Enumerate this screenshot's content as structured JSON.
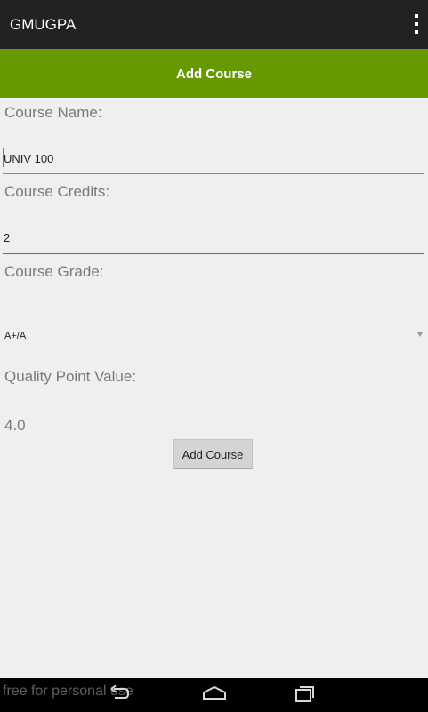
{
  "app": {
    "title": "GMUGPA"
  },
  "header": {
    "title": "Add Course"
  },
  "form": {
    "course_name": {
      "label": "Course Name:",
      "value": "UNIV 100",
      "value_part1": "UNIV",
      "value_part2": " 100"
    },
    "course_credits": {
      "label": "Course Credits:",
      "value": "2"
    },
    "course_grade": {
      "label": "Course Grade:",
      "selected": "A+/A"
    },
    "quality_point": {
      "label": "Quality Point Value:",
      "value": "4.0"
    },
    "submit_label": "Add Course"
  },
  "watermark": "free for personal use",
  "navbar": {
    "icons": [
      "back-icon",
      "home-icon",
      "recent-apps-icon"
    ]
  },
  "colors": {
    "header_bg": "#669900",
    "actionbar_bg": "#222222",
    "accent": "#4aa7a5",
    "background": "#efefef"
  }
}
